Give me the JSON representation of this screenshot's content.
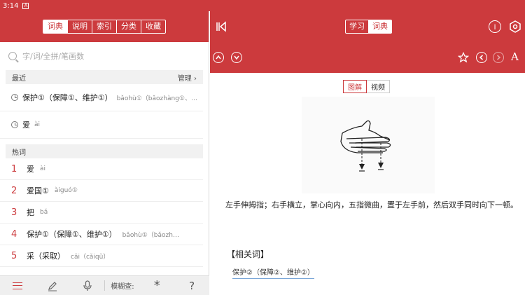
{
  "status": {
    "time": "3:14",
    "badge": "A"
  },
  "left": {
    "tabs": [
      "词典",
      "说明",
      "索引",
      "分类",
      "收藏"
    ],
    "active_tab": 0,
    "search": {
      "placeholder": "字/词/全拼/笔画数"
    },
    "recent": {
      "title": "最近",
      "manage": "管理 ›",
      "items": [
        {
          "word": "保护①（保障①、维护①）",
          "pinyin": "bǎohù①（bǎozhàng①、…"
        },
        {
          "word": "爱",
          "pinyin": "ài"
        }
      ]
    },
    "hot": {
      "title": "热词",
      "items": [
        {
          "num": "1",
          "word": "爱",
          "pinyin": "ài"
        },
        {
          "num": "2",
          "word": "爱国①",
          "pinyin": "àiguó①"
        },
        {
          "num": "3",
          "word": "把",
          "pinyin": "bǎ"
        },
        {
          "num": "4",
          "word": "保护①（保障①、维护①）",
          "pinyin": "bǎohù①（bǎozh…"
        },
        {
          "num": "5",
          "word": "采（采取）",
          "pinyin": "cǎi（cǎiqǔ）"
        }
      ]
    },
    "bottom": {
      "fuzzy_label": "模糊查:",
      "star": "*",
      "help": "?"
    }
  },
  "right": {
    "tabs": [
      "学习",
      "词典"
    ],
    "active_tab": 1,
    "media_tabs": [
      "图解",
      "视频"
    ],
    "description": "左手伸拇指；右手横立，掌心向内，五指微曲，置于左手前，然后双手同时向下一顿。",
    "related_title": "【相关词】",
    "related_word": "保护②（保障②、维护②）",
    "info_symbol": "i",
    "font_symbol": "A"
  },
  "colors": {
    "accent": "#cc3a3d"
  }
}
